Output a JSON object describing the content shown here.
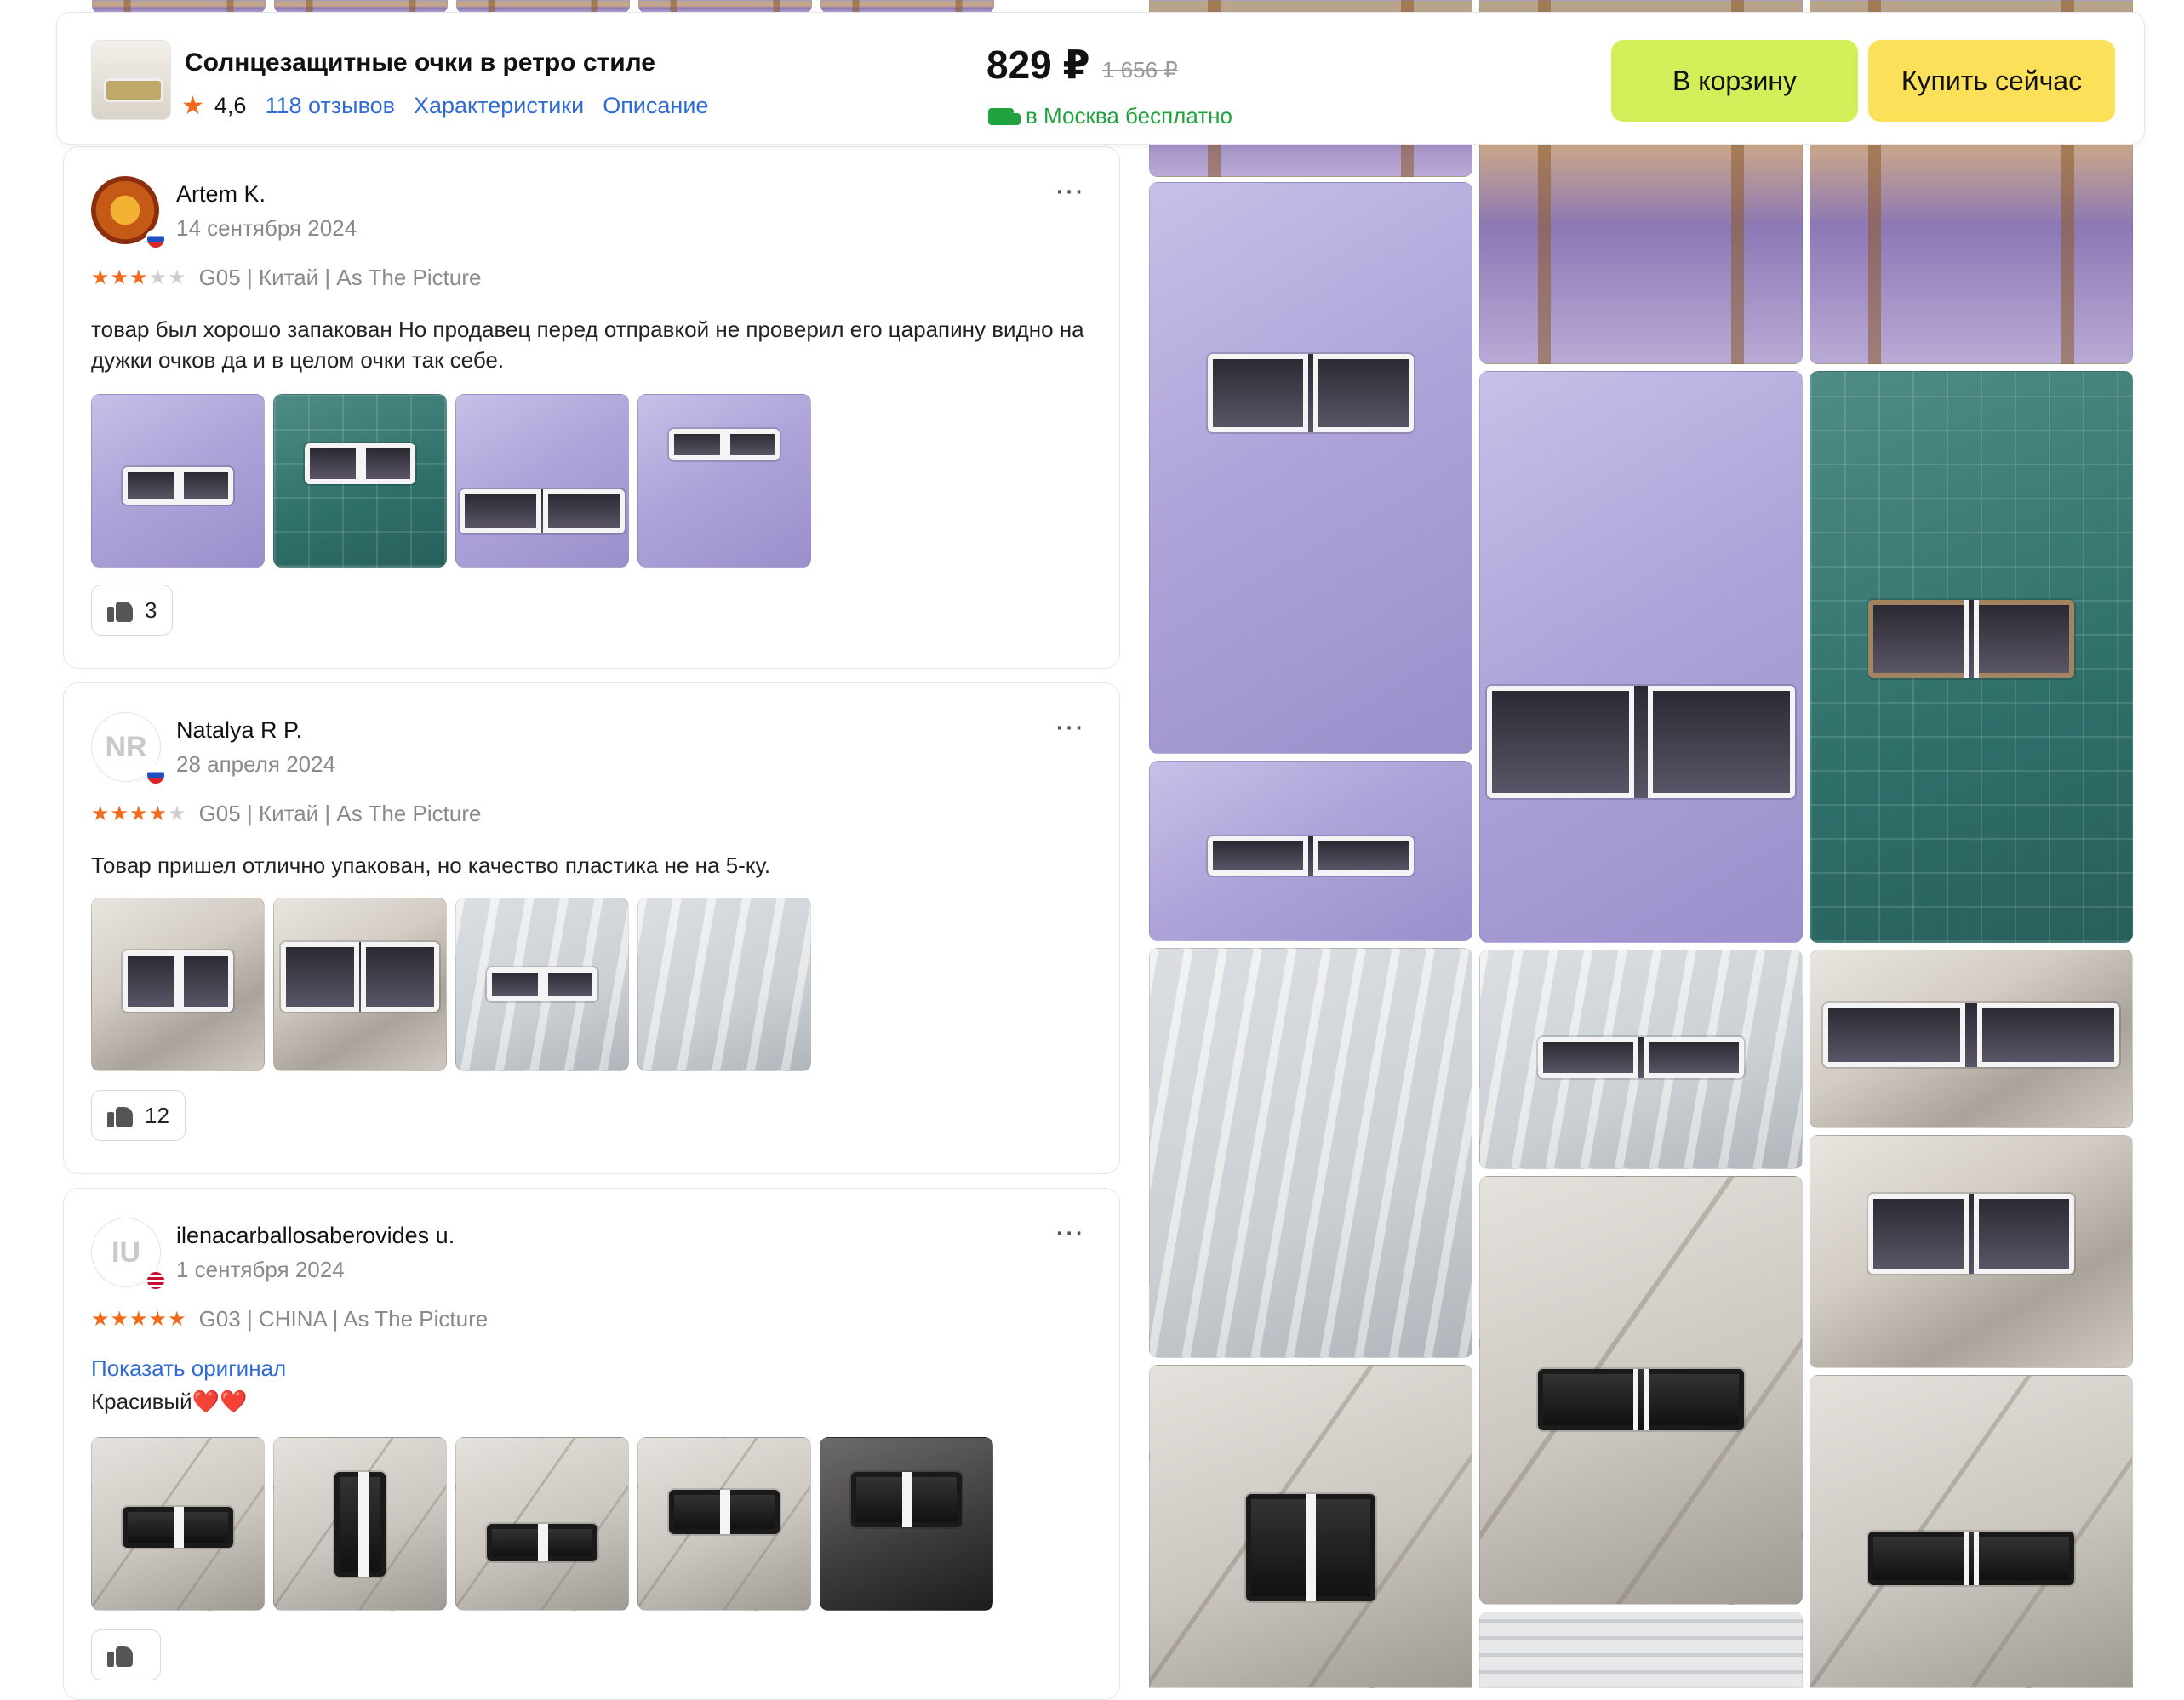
{
  "header": {
    "product_title": "Солнцезащитные очки в ретро стиле",
    "rating": "4,6",
    "reviews_link": "118 отзывов",
    "specs_link": "Характеристики",
    "description_link": "Описание",
    "price": "829 ₽",
    "old_price": "1 656 ₽",
    "delivery": "в Москва бесплатно",
    "cart_button": "В корзину",
    "buy_button": "Купить сейчас"
  },
  "reviews": [
    {
      "user": "Artem K.",
      "date": "14 сентября 2024",
      "rating": 3,
      "stars_text": "★★★★★",
      "variant": "G05 | Китай | As The Picture",
      "text": "товар был хорошо запакован Но продавец перед отправкой не проверил его царапину видно на дужки очков да и в целом очки так себе.",
      "likes": "3",
      "avatar_type": "image",
      "flag": "ru"
    },
    {
      "user": "Natalya R P.",
      "date": "28 апреля 2024",
      "rating": 4,
      "initials": "NR",
      "variant": "G05 | Китай | As The Picture",
      "text": "Товар пришел отлично упакован, но качество пластика не на 5-ку.",
      "likes": "12",
      "flag": "ru"
    },
    {
      "user": "ilenacarballosaberovides u.",
      "date": "1 сентября 2024",
      "rating": 5,
      "initials": "IU",
      "variant": "G03 | CHINA | As The Picture",
      "show_original": "Показать оригинал",
      "text": "Красивый❤️❤️",
      "likes": "",
      "flag": "us"
    }
  ],
  "more_icon": "⋯",
  "colors": {
    "accent_orange": "#f26a1b",
    "link_blue": "#2e6bd6",
    "delivery_green": "#1ea33f",
    "cart_button": "#d2ef5a",
    "buy_button": "#fbe15a"
  }
}
